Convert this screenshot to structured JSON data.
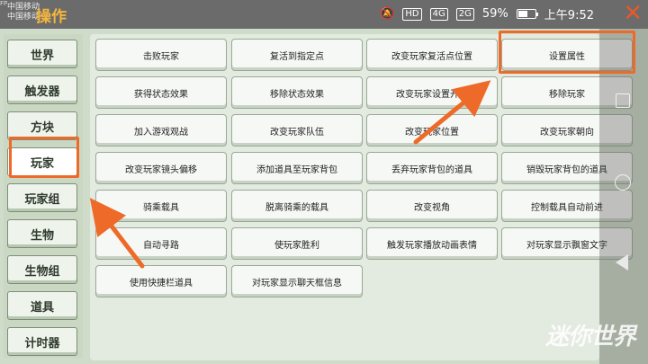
{
  "status_bar": {
    "carrier_top": "中国移动",
    "carrier_bottom": "中国移动",
    "fp_tag": "FP",
    "hd_label": "HD",
    "signal_a": "4G",
    "signal_b": "2G",
    "battery": "59%",
    "battery_level": 0.59,
    "time": "上午9:52"
  },
  "header": {
    "title": "操作",
    "close_label": "✕"
  },
  "sidebar": {
    "items": [
      {
        "label": "世界"
      },
      {
        "label": "触发器"
      },
      {
        "label": "方块"
      },
      {
        "label": "玩家",
        "active": true
      },
      {
        "label": "玩家组"
      },
      {
        "label": "生物"
      },
      {
        "label": "生物组"
      },
      {
        "label": "道具"
      },
      {
        "label": "计时器"
      }
    ]
  },
  "actions": [
    "击败玩家",
    "复活到指定点",
    "改变玩家复活点位置",
    "设置属性",
    "获得状态效果",
    "移除状态效果",
    "改变玩家设置开关",
    "移除玩家",
    "加入游戏观战",
    "改变玩家队伍",
    "改变玩家位置",
    "改变玩家朝向",
    "改变玩家镜头偏移",
    "添加道具至玩家背包",
    "丢弃玩家背包的道具",
    "销毁玩家背包的道具",
    "骑乘载具",
    "脱离骑乘的载具",
    "改变视角",
    "控制载具自动前进",
    "自动寻路",
    "使玩家胜利",
    "触发玩家播放动画表情",
    "对玩家显示飘窗文字",
    "使用快捷栏道具",
    "对玩家显示聊天框信息"
  ],
  "watermark": "迷你世界",
  "colors": {
    "accent_highlight": "#ee6a28",
    "panel_bg": "#cfdcc9",
    "title": "#f6b73c"
  }
}
